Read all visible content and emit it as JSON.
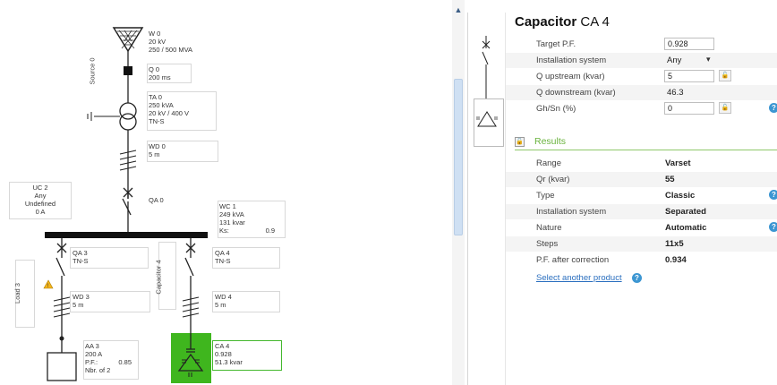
{
  "diagram": {
    "source": {
      "name": "W 0",
      "voltage": "20 kV",
      "power": "250 / 500 MVA",
      "vertical_label": "Source 0"
    },
    "q0": {
      "name": "Q 0",
      "time": "200 ms"
    },
    "ta0": {
      "name": "TA 0",
      "power": "250 kVA",
      "ratio": "20 kV / 400 V",
      "system": "TN-S"
    },
    "wd0": {
      "name": "WD 0",
      "length": "5 m"
    },
    "uc2": {
      "name": "UC 2",
      "line1": "Any",
      "line2": "Undefined",
      "current": "0 A"
    },
    "qa0": {
      "name": "QA 0"
    },
    "wc1": {
      "name": "WC 1",
      "power": "249 kVA",
      "reactive": "131 kvar",
      "ks_label": "Ks:",
      "ks_value": "0.9"
    },
    "qa3": {
      "name": "QA 3",
      "system": "TN-S"
    },
    "qa4": {
      "name": "QA 4",
      "system": "TN-S"
    },
    "load3_label": "Load 3",
    "capacitor4_label": "Capacitor 4",
    "wd3": {
      "name": "WD 3",
      "length": "5 m"
    },
    "wd4": {
      "name": "WD 4",
      "length": "5 m"
    },
    "aa3": {
      "name": "AA 3",
      "current": "200 A",
      "pf_label": "P.F.:",
      "pf_value": "0.85",
      "nbr": "Nbr. of 2"
    },
    "ca4": {
      "name": "CA 4",
      "pf": "0.928",
      "reactive": "51.3 kvar"
    }
  },
  "panel": {
    "title_bold": "Capacitor",
    "title_name": "CA 4",
    "inputs": [
      {
        "label": "Target P.F.",
        "value": "0.928"
      },
      {
        "label": "Installation system",
        "value": "Any",
        "arrow": "▾"
      },
      {
        "label": "Q upstream (kvar)",
        "value": "5"
      },
      {
        "label": "Q downstream (kvar)",
        "value": "46.3"
      },
      {
        "label": "Gh/Sn (%)",
        "value": "0"
      }
    ],
    "results_label": "Results",
    "results": [
      {
        "label": "Range",
        "value": "Varset"
      },
      {
        "label": "Qr (kvar)",
        "value": "55"
      },
      {
        "label": "Type",
        "value": "Classic"
      },
      {
        "label": "Installation system",
        "value": "Separated"
      },
      {
        "label": "Nature",
        "value": "Automatic"
      },
      {
        "label": "Steps",
        "value": "11x5"
      },
      {
        "label": "P.F. after correction",
        "value": "0.934"
      }
    ],
    "select_link": "Select another product",
    "help_glyph": "?",
    "lock_glyph": "🔓"
  },
  "colors": {
    "accent_green": "#3fb61e",
    "link_blue": "#2b6fbf",
    "help_blue": "#3c96d2"
  }
}
